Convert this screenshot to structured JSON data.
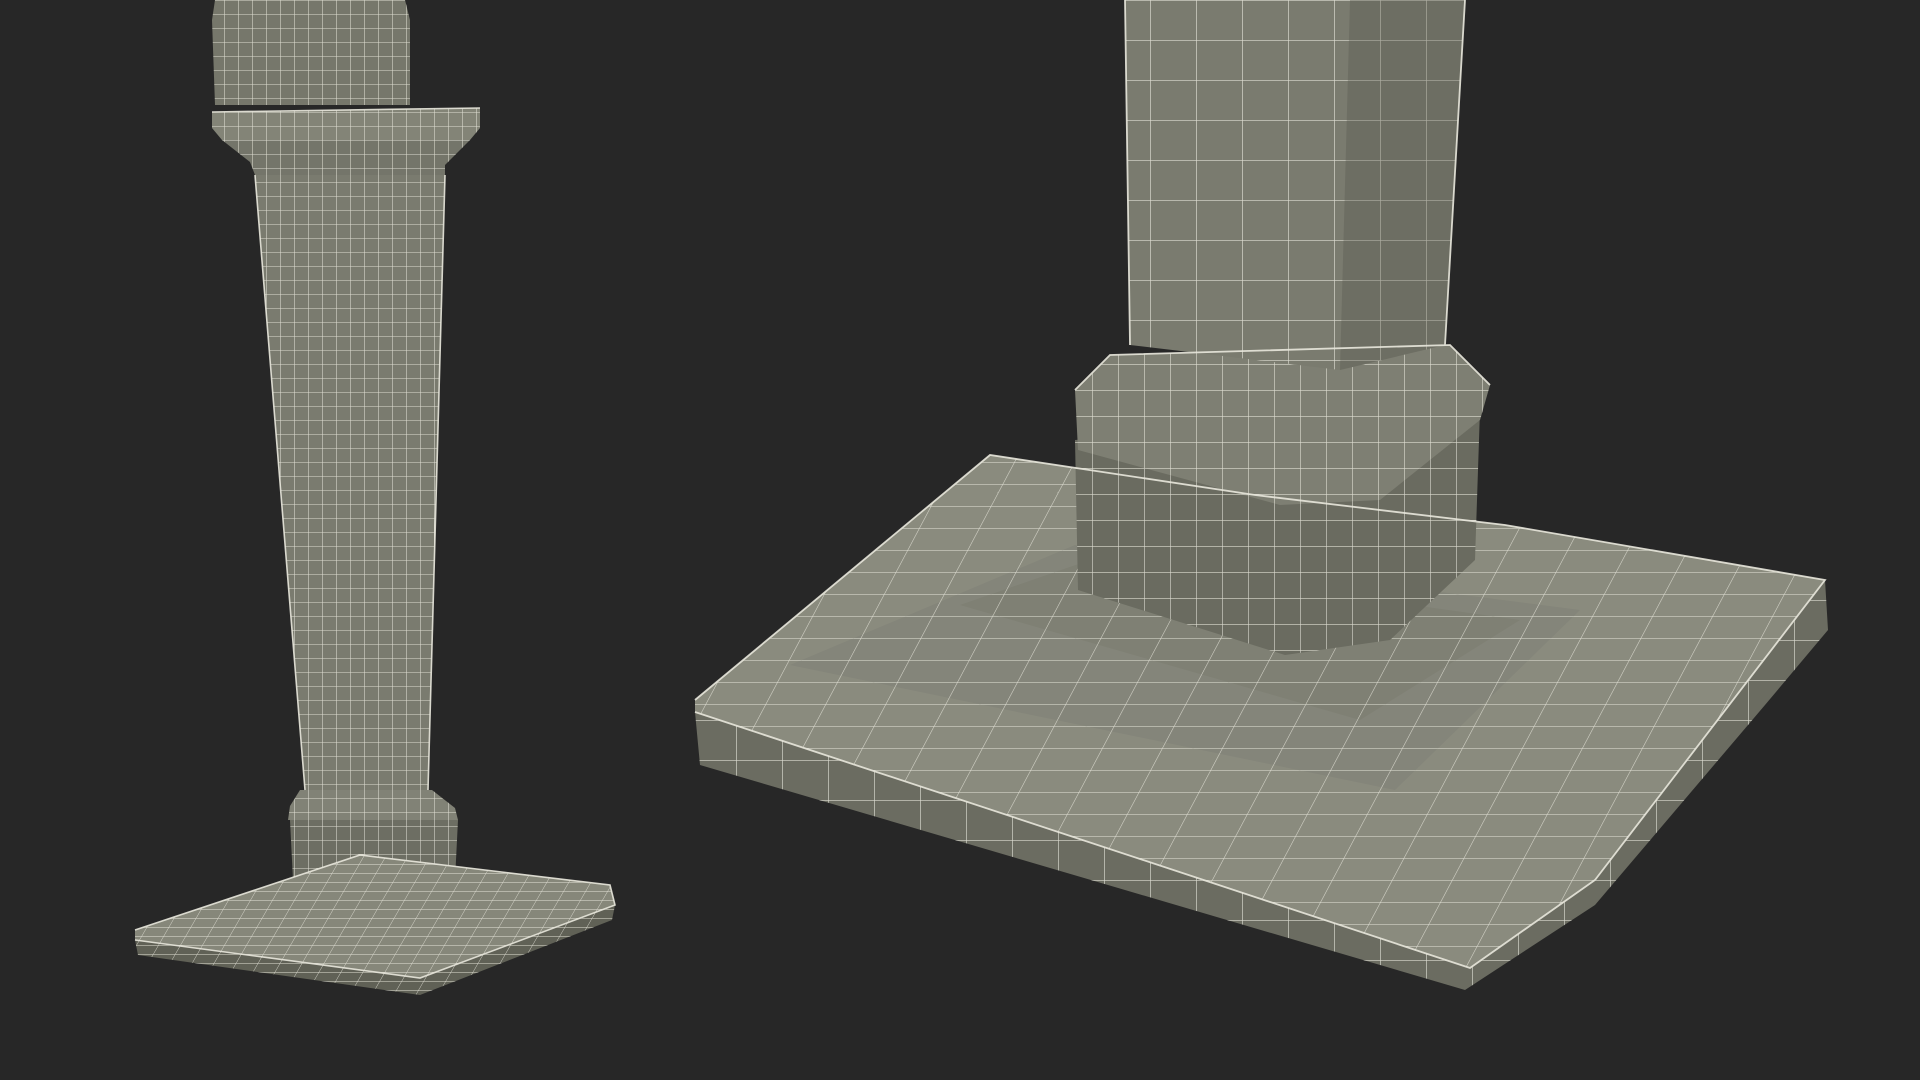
{
  "scene": {
    "background_color": "#272727",
    "surface_color": "#7b7c70",
    "surface_shade_color": "#66675c",
    "surface_dark_color": "#55564d",
    "wire_color": "#e9e8dd",
    "objects": [
      "pedestal-column-full-view",
      "pedestal-base-closeup"
    ]
  }
}
